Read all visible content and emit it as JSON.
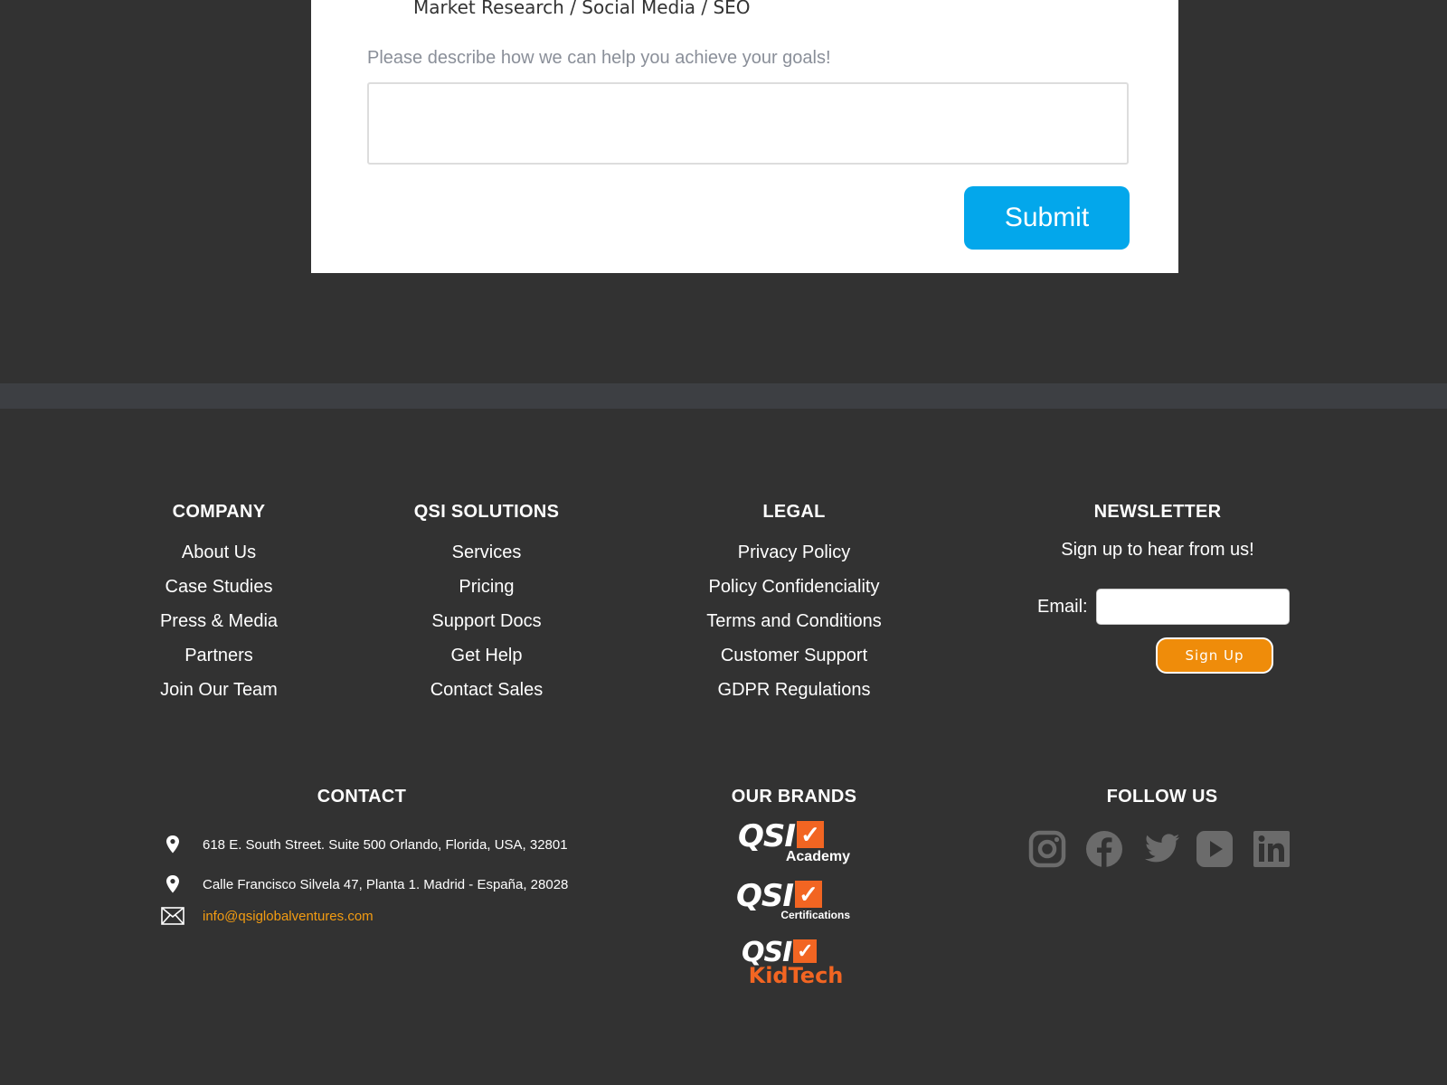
{
  "form": {
    "service_option": "Market Research / Social Media / SEO",
    "goals_label": "Please describe how we can help you achieve your goals!",
    "goals_value": "",
    "submit_label": "Submit"
  },
  "footer": {
    "company": {
      "heading": "COMPANY",
      "links": [
        "About Us",
        "Case Studies",
        "Press & Media",
        "Partners",
        "Join Our Team"
      ]
    },
    "solutions": {
      "heading": "QSI SOLUTIONS",
      "links": [
        "Services",
        "Pricing",
        "Support Docs",
        "Get Help",
        "Contact Sales"
      ]
    },
    "legal": {
      "heading": "LEGAL",
      "links": [
        "Privacy Policy",
        "Policy Confidenciality",
        "Terms and Conditions",
        "Customer Support",
        "GDPR Regulations"
      ]
    },
    "newsletter": {
      "heading": "NEWSLETTER",
      "subtitle": "Sign up to hear from us!",
      "email_label": "Email:",
      "email_value": "",
      "signup_label": "Sign Up"
    },
    "contact": {
      "heading": "CONTACT",
      "address_1": "618 E. South Street. Suite 500 Orlando, Florida, USA, 32801",
      "address_2": "Calle Francisco Silvela 47, Planta 1. Madrid - España, 28028",
      "email": "info@qsiglobalventures.com",
      "icons": [
        "map-pin-icon",
        "map-pin-icon",
        "envelope-icon"
      ]
    },
    "brands": {
      "heading": "OUR BRANDS",
      "logos": [
        {
          "mark": "QSI",
          "sub": "Academy"
        },
        {
          "mark": "QSI",
          "sub": "Certifications"
        },
        {
          "mark": "QSI",
          "sub": "KidTech"
        }
      ]
    },
    "follow": {
      "heading": "FOLLOW US",
      "icons": [
        "instagram-icon",
        "facebook-icon",
        "twitter-icon",
        "youtube-icon",
        "linkedin-icon"
      ]
    }
  },
  "colors": {
    "background": "#323232",
    "band": "#3d3f43",
    "submit_blue": "#03a7eb",
    "signup_orange": "#ef8c0a",
    "email_link": "#f39c12",
    "brand_orange": "#f26522",
    "social_grey": "#6b6b6b"
  }
}
